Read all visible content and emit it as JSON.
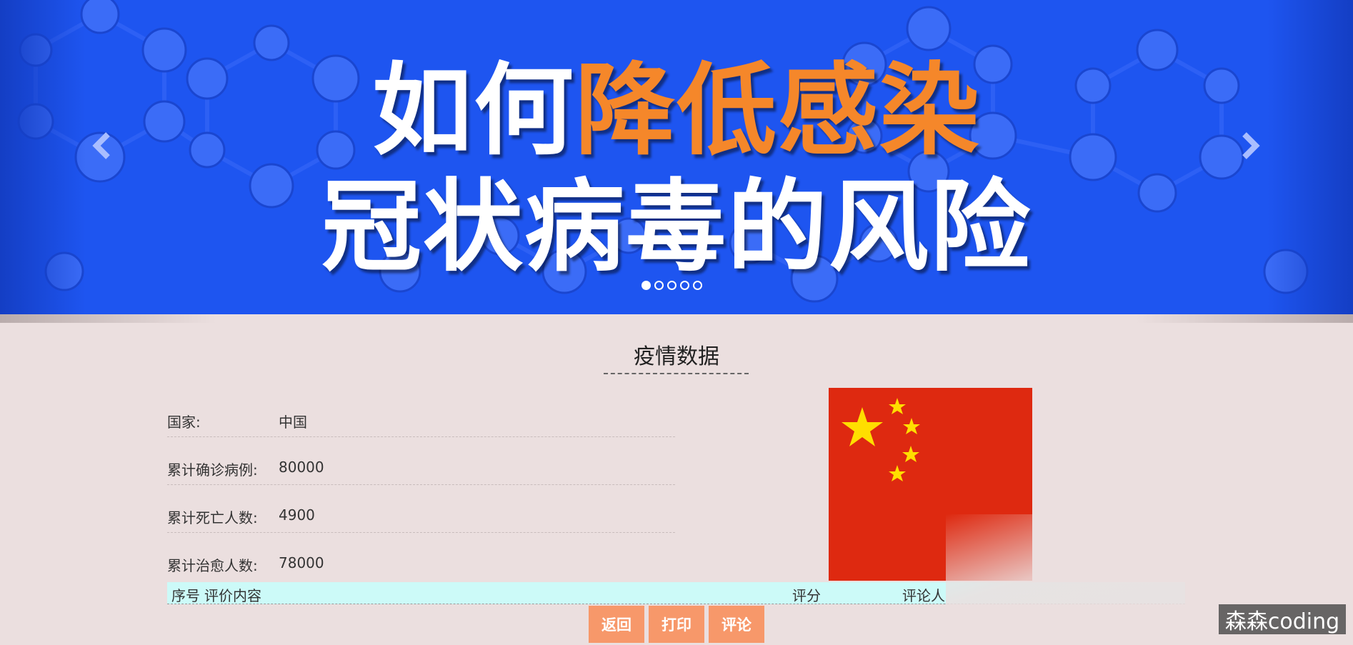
{
  "banner": {
    "line1_plain": "如何",
    "line1_highlight": "降低感染",
    "line2": "冠状病毒的风险",
    "prev_icon": "chevron-left-icon",
    "next_icon": "chevron-right-icon",
    "slide_count": 5,
    "active_slide": 1,
    "colors": {
      "background": "#1e55f0",
      "highlight": "#f5872a"
    }
  },
  "section": {
    "title": "疫情数据"
  },
  "info": [
    {
      "label": "国家:",
      "value": "中国"
    },
    {
      "label": "累计确诊病例:",
      "value": "80000"
    },
    {
      "label": "累计死亡人数:",
      "value": "4900"
    },
    {
      "label": "累计治愈人数:",
      "value": "78000"
    }
  ],
  "flag": {
    "icon": "china-flag-image",
    "colors": {
      "red": "#de2910",
      "yellow": "#ffde00"
    }
  },
  "table": {
    "headers": [
      "序号",
      "评价内容",
      "评分",
      "评论人"
    ]
  },
  "buttons": {
    "back": "返回",
    "print": "打印",
    "comment": "评论",
    "color": "#f7986a"
  },
  "watermark": "森森coding"
}
